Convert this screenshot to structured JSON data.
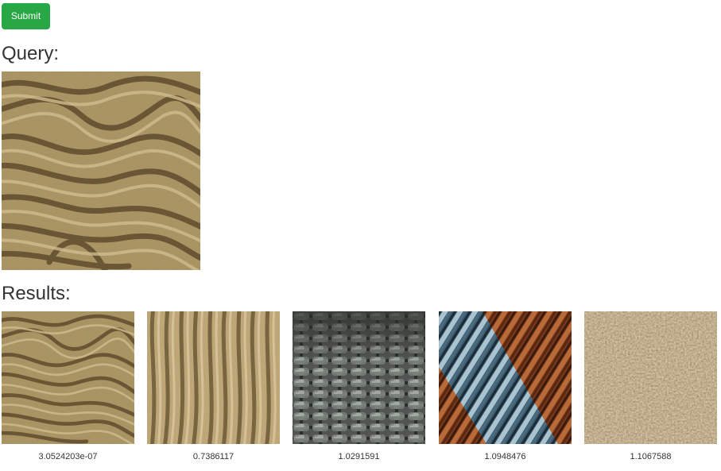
{
  "toolbar": {
    "submit_label": "Submit",
    "submit_color": "#28a745"
  },
  "query": {
    "heading": "Query:",
    "image_texture": "sand-ripples"
  },
  "results": {
    "heading": "Results:",
    "items": [
      {
        "texture": "sand-ripples",
        "score": "3.0524203e-07"
      },
      {
        "texture": "sand-ripples-vertical",
        "score": "0.7386117"
      },
      {
        "texture": "cobblestones",
        "score": "1.0291591"
      },
      {
        "texture": "corrugated-metal",
        "score": "1.0948476"
      },
      {
        "texture": "gravel",
        "score": "1.1067588"
      }
    ]
  }
}
